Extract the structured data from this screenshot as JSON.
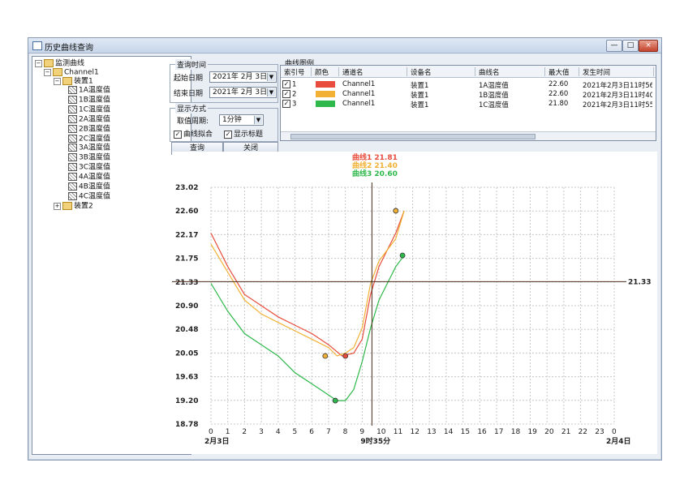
{
  "window": {
    "title": "历史曲线查询",
    "controls": [
      "—",
      "□",
      "×"
    ]
  },
  "tree": {
    "root": "监测曲线",
    "channel": "Channel1",
    "device": "装置1",
    "sensors": [
      "1A温度值",
      "1B温度值",
      "1C温度值",
      "2A温度值",
      "2B温度值",
      "2C温度值",
      "3A温度值",
      "3B温度值",
      "3C温度值",
      "4A温度值",
      "4B温度值",
      "4C温度值"
    ],
    "device2": "装置2"
  },
  "query": {
    "group_label": "查询时间",
    "start_label": "起始日期",
    "start_value": "2021年 2月 3日",
    "end_label": "结束日期",
    "end_value": "2021年 2月 3日"
  },
  "display": {
    "group_label": "显示方式",
    "period_label": "取值周期:",
    "period_value": "1分钟",
    "smooth_label": "曲线拟合",
    "title_label": "显示标题",
    "query_button": "查询",
    "close_button": "关闭"
  },
  "table": {
    "group_label": "曲线图例",
    "headers": [
      "索引号",
      "颜色",
      "通道名",
      "设备名",
      "曲线名",
      "最大值",
      "发生时间"
    ],
    "rows": [
      {
        "index": "1",
        "color": "#e74c3c",
        "channel": "Channel1",
        "device": "装置1",
        "curve": "1A温度值",
        "max": "22.60",
        "time": "2021年2月3日11时56"
      },
      {
        "index": "2",
        "color": "#f2b134",
        "channel": "Channel1",
        "device": "装置1",
        "curve": "1B温度值",
        "max": "22.60",
        "time": "2021年2月3日11时40"
      },
      {
        "index": "3",
        "color": "#2eb84b",
        "channel": "Channel1",
        "device": "装置1",
        "curve": "1C温度值",
        "max": "21.80",
        "time": "2021年2月3日11时55"
      }
    ]
  },
  "chart_data": {
    "type": "line",
    "legend": [
      {
        "name": "曲线1",
        "value": "21.81",
        "color": "#e74c3c"
      },
      {
        "name": "曲线2",
        "value": "21.40",
        "color": "#f2b134"
      },
      {
        "name": "曲线3",
        "value": "20.60",
        "color": "#2eb84b"
      }
    ],
    "ylim": [
      18.78,
      23.02
    ],
    "yticks": [
      "23.02",
      "22.60",
      "22.17",
      "21.75",
      "21.33",
      "20.90",
      "20.48",
      "20.05",
      "19.63",
      "19.20",
      "18.78"
    ],
    "xlim": [
      0,
      24
    ],
    "xticks": [
      "0",
      "1",
      "2",
      "3",
      "4",
      "5",
      "6",
      "7",
      "8",
      "9",
      "10",
      "11",
      "12",
      "13",
      "14",
      "15",
      "16",
      "17",
      "18",
      "19",
      "20",
      "21",
      "22",
      "23",
      "0"
    ],
    "x_start_label": "2月3日",
    "x_end_label": "2月4日",
    "cursor_label": "9时35分",
    "cursor_x": 9.58,
    "hline_value": 21.33,
    "hline_label": "21.33",
    "series": [
      {
        "name": "曲线1",
        "color": "#e74c3c",
        "x": [
          0,
          1,
          2,
          3,
          4,
          5,
          6,
          7,
          7.8,
          8.5,
          9,
          9.5,
          10,
          10.5,
          11,
          11.5
        ],
        "y": [
          22.2,
          21.6,
          21.1,
          20.9,
          20.7,
          20.55,
          20.4,
          20.2,
          20.0,
          20.05,
          20.3,
          21.1,
          21.6,
          21.9,
          22.2,
          22.6
        ]
      },
      {
        "name": "曲线2",
        "color": "#f2b134",
        "x": [
          0,
          1,
          2,
          3,
          4,
          5,
          6,
          7,
          7.5,
          8,
          8.5,
          9,
          9.5,
          10,
          10.5,
          11,
          11.5
        ],
        "y": [
          22.0,
          21.5,
          21.0,
          20.75,
          20.6,
          20.45,
          20.3,
          20.15,
          20.0,
          20.05,
          20.15,
          20.5,
          21.3,
          21.7,
          21.9,
          22.1,
          22.6
        ]
      },
      {
        "name": "曲线3",
        "color": "#2eb84b",
        "x": [
          0,
          1,
          2,
          3,
          4,
          5,
          6,
          6.5,
          7,
          7.5,
          8,
          8.5,
          9,
          9.5,
          10,
          10.5,
          11,
          11.5
        ],
        "y": [
          21.3,
          20.8,
          20.4,
          20.2,
          20.0,
          19.7,
          19.5,
          19.4,
          19.3,
          19.2,
          19.2,
          19.4,
          19.9,
          20.5,
          21.0,
          21.3,
          21.6,
          21.8
        ]
      }
    ],
    "markers": [
      {
        "series": 0,
        "x": 8.0,
        "y": 20.0,
        "color": "#e74c3c"
      },
      {
        "series": 1,
        "x": 6.8,
        "y": 20.0,
        "color": "#f2b134"
      },
      {
        "series": 1,
        "x": 11.0,
        "y": 22.6,
        "color": "#f2b134"
      },
      {
        "series": 2,
        "x": 7.4,
        "y": 19.2,
        "color": "#2eb84b"
      },
      {
        "series": 2,
        "x": 11.4,
        "y": 21.8,
        "color": "#2eb84b"
      }
    ]
  }
}
